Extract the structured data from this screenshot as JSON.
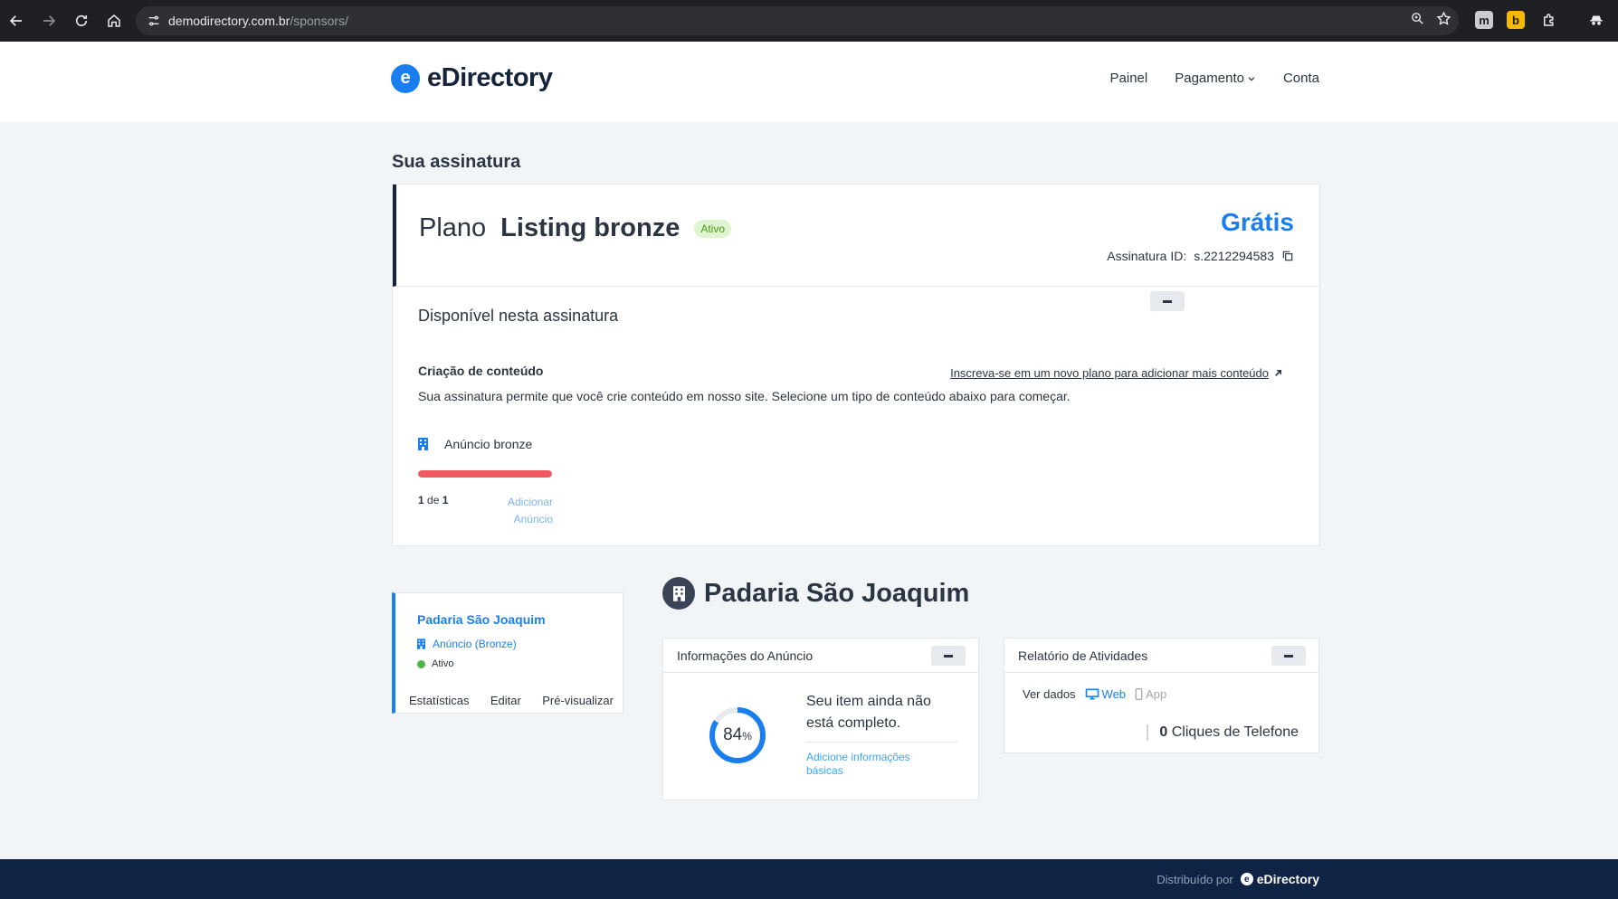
{
  "browser": {
    "url_host": "demodirectory.com.br",
    "url_path": "/sponsors/",
    "extensions": [
      "m",
      "b"
    ]
  },
  "header": {
    "logo_mark": "e",
    "logo_text": "eDirectory",
    "nav": {
      "painel": "Painel",
      "pagamento": "Pagamento",
      "conta": "Conta"
    }
  },
  "subscription": {
    "section_title": "Sua assinatura",
    "plan_prefix": "Plano",
    "plan_name": "Listing bronze",
    "status": "Ativo",
    "price": "Grátis",
    "id_label": "Assinatura ID:",
    "id_value": "s.2212294583",
    "available_title": "Disponível nesta assinatura",
    "content_title": "Criação de conteúdo",
    "upgrade_link": "Inscreva-se em um novo plano para adicionar mais conteúdo",
    "content_desc": "Sua assinatura permite que você crie conteúdo em nosso site. Selecione um tipo de conteúdo abaixo para começar.",
    "ad_type": "Anúncio bronze",
    "usage_fraction": 1.0,
    "count_used": "1",
    "count_sep": "de",
    "count_total": "1",
    "add_link": "Adicionar Anúncio"
  },
  "listing_card": {
    "name": "Padaria São Joaquim",
    "type": "Anúncio (Bronze)",
    "status": "Ativo",
    "actions": {
      "stats": "Estatísticas",
      "edit": "Editar",
      "preview": "Pré-visualizar"
    }
  },
  "listing": {
    "title": "Padaria São Joaquim",
    "info": {
      "title": "Informações do Anúncio",
      "percent": 84,
      "percent_value": "84",
      "percent_sign": "%",
      "message": "Seu item ainda não está completo.",
      "link": "Adicione informações básicas"
    },
    "report": {
      "title": "Relatório de Atividades",
      "view_label": "Ver dados",
      "web": "Web",
      "app": "App",
      "stat_value": "0",
      "stat_label": "Cliques de Telefone"
    }
  },
  "footer": {
    "powered": "Distribuído por",
    "brand": "eDirectory",
    "brand_mark": "e"
  },
  "colors": {
    "brand": "#1b7ef0",
    "progress": "#ee5a5f",
    "active": "#4bb543",
    "footer": "#0f2445"
  }
}
